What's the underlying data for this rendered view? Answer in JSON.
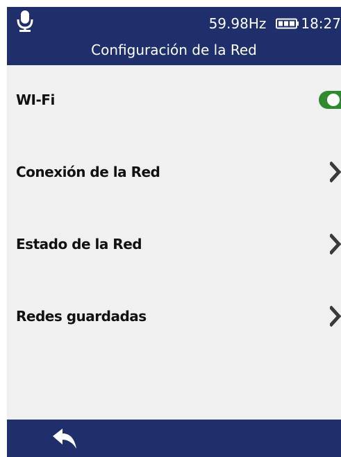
{
  "status_bar": {
    "frequency": "59.98Hz",
    "time": "18:27",
    "icons": {
      "mic": "microphone-icon",
      "battery": "battery-icon"
    }
  },
  "header": {
    "title": "Configuración de la Red"
  },
  "settings": {
    "items": [
      {
        "label": "WI-Fi",
        "control": "toggle",
        "enabled": true
      },
      {
        "label": "Conexión de la Red",
        "control": "chevron"
      },
      {
        "label": "Estado de la Red",
        "control": "chevron"
      },
      {
        "label": "Redes guardadas",
        "control": "chevron"
      }
    ]
  },
  "footer": {
    "icons": {
      "back": "back-arrow-icon"
    }
  },
  "colors": {
    "header_bg": "#1f2f6b",
    "body_bg": "#f0f0f0",
    "toggle_on": "#2e8b2e",
    "chevron": "#3a3a3a",
    "text": "#111111"
  }
}
